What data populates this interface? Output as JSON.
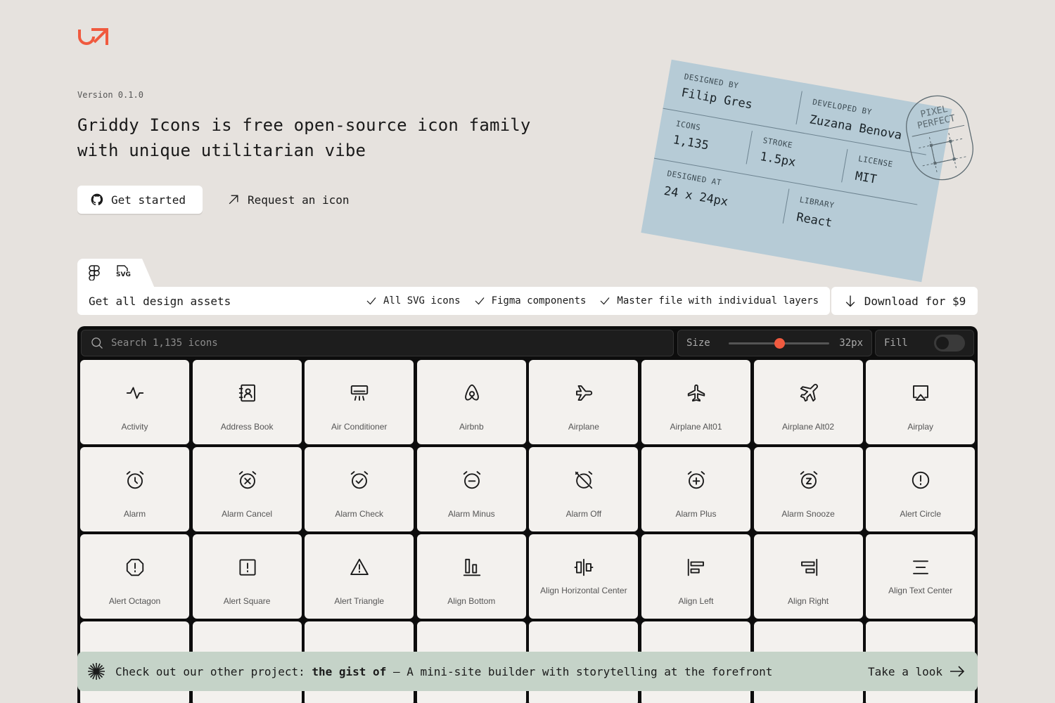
{
  "brand": {
    "accent": "#f05a3f"
  },
  "hero": {
    "version": "Version 0.1.0",
    "headline": "Griddy Icons is free open-source icon family with unique utilitarian vibe",
    "get_started": "Get started",
    "request_icon": "Request an icon"
  },
  "ticket": {
    "designed_by_label": "DESIGNED BY",
    "designed_by": "Filip Gres",
    "developed_by_label": "DEVELOPED BY",
    "developed_by": "Zuzana Benova",
    "icons_label": "ICONS",
    "icons": "1,135",
    "stroke_label": "STROKE",
    "stroke": "1.5px",
    "license_label": "LICENSE",
    "license": "MIT",
    "designed_at_label": "DESIGNED AT",
    "designed_at": "24 x 24px",
    "library_label": "LIBRARY",
    "library": "React",
    "stamp_line1": "PIXEL",
    "stamp_line2": "PERFECT"
  },
  "assets": {
    "tab_figma": "figma-icon",
    "tab_svg": "SVG",
    "title": "Get all design assets",
    "features": [
      "All SVG icons",
      "Figma components",
      "Master file with individual layers"
    ],
    "download": "Download for $9"
  },
  "toolbar": {
    "search_placeholder": "Search 1,135 icons",
    "size_label": "Size",
    "size_value": "32px",
    "size_fraction": 0.5,
    "fill_label": "Fill",
    "fill_on": false
  },
  "icons": [
    {
      "name": "Activity",
      "icon": "activity"
    },
    {
      "name": "Address Book",
      "icon": "address-book"
    },
    {
      "name": "Air Conditioner",
      "icon": "air-conditioner"
    },
    {
      "name": "Airbnb",
      "icon": "airbnb"
    },
    {
      "name": "Airplane",
      "icon": "airplane"
    },
    {
      "name": "Airplane Alt01",
      "icon": "airplane-alt01"
    },
    {
      "name": "Airplane Alt02",
      "icon": "airplane-alt02"
    },
    {
      "name": "Airplay",
      "icon": "airplay"
    },
    {
      "name": "Alarm",
      "icon": "alarm"
    },
    {
      "name": "Alarm Cancel",
      "icon": "alarm-cancel"
    },
    {
      "name": "Alarm Check",
      "icon": "alarm-check"
    },
    {
      "name": "Alarm Minus",
      "icon": "alarm-minus"
    },
    {
      "name": "Alarm Off",
      "icon": "alarm-off"
    },
    {
      "name": "Alarm Plus",
      "icon": "alarm-plus"
    },
    {
      "name": "Alarm Snooze",
      "icon": "alarm-snooze"
    },
    {
      "name": "Alert Circle",
      "icon": "alert-circle"
    },
    {
      "name": "Alert Octagon",
      "icon": "alert-octagon"
    },
    {
      "name": "Alert Square",
      "icon": "alert-square"
    },
    {
      "name": "Alert Triangle",
      "icon": "alert-triangle"
    },
    {
      "name": "Align Bottom",
      "icon": "align-bottom"
    },
    {
      "name": "Align Horizontal Center",
      "icon": "align-horizontal-center"
    },
    {
      "name": "Align Left",
      "icon": "align-left"
    },
    {
      "name": "Align Right",
      "icon": "align-right"
    },
    {
      "name": "Align Text Center",
      "icon": "align-text-center"
    }
  ],
  "banner": {
    "prefix": "Check out our other project:",
    "project": "the gist of",
    "suffix": "— A mini-site builder with storytelling at the forefront",
    "cta": "Take a look"
  }
}
